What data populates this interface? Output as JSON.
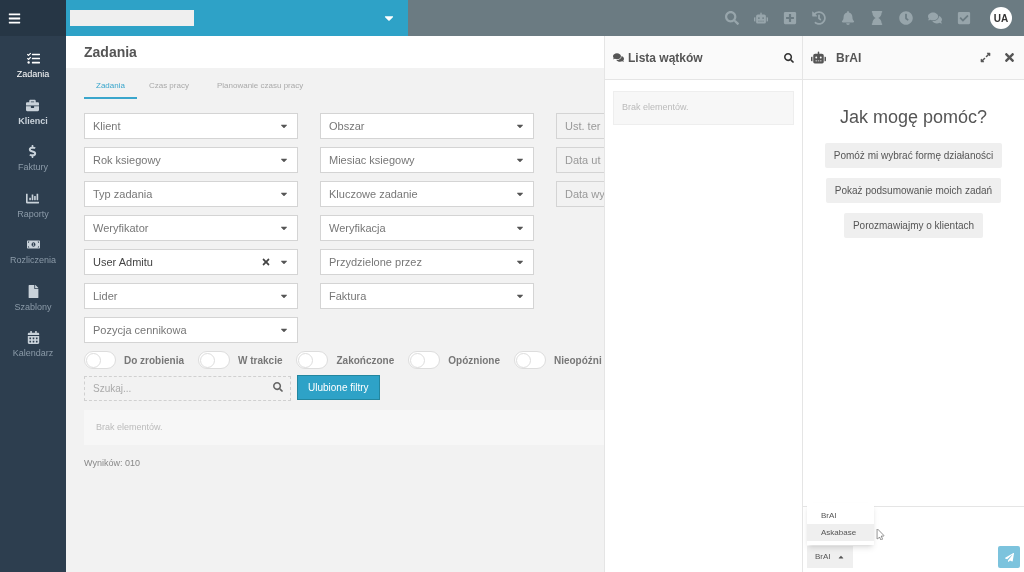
{
  "topbar": {
    "avatar": "UA"
  },
  "sidebar": {
    "items": [
      {
        "label": "Zadania",
        "selected": true,
        "hover": false
      },
      {
        "label": "Klienci",
        "selected": false,
        "hover": true
      },
      {
        "label": "Faktury",
        "selected": false,
        "hover": false
      },
      {
        "label": "Raporty",
        "selected": false,
        "hover": false
      },
      {
        "label": "Rozliczenia",
        "selected": false,
        "hover": false
      },
      {
        "label": "Szablony",
        "selected": false,
        "hover": false
      },
      {
        "label": "Kalendarz",
        "selected": false,
        "hover": false
      }
    ]
  },
  "page": {
    "title": "Zadania",
    "tabs": [
      {
        "label": "Zadania",
        "selected": true
      },
      {
        "label": "Czas pracy",
        "selected": false
      },
      {
        "label": "Planowanie czasu pracy",
        "selected": false
      }
    ],
    "filters_left": [
      {
        "placeholder": "Klient"
      },
      {
        "placeholder": "Rok ksiegowy"
      },
      {
        "placeholder": "Typ zadania"
      },
      {
        "placeholder": "Weryfikator"
      },
      {
        "value": "User Admitu",
        "clearable": true
      },
      {
        "placeholder": "Lider"
      },
      {
        "placeholder": "Pozycja cennikowa"
      }
    ],
    "filters_middle": [
      {
        "placeholder": "Obszar"
      },
      {
        "placeholder": "Miesiac ksiegowy"
      },
      {
        "placeholder": "Kluczowe zadanie"
      },
      {
        "placeholder": "Weryfikacja"
      },
      {
        "placeholder": "Przydzielone przez"
      },
      {
        "placeholder": "Faktura"
      }
    ],
    "filters_right": [
      {
        "placeholder": "Ust. ter"
      },
      {
        "placeholder": "Data ut"
      },
      {
        "placeholder": "Data wy"
      }
    ],
    "toggles": [
      {
        "label": "Do zrobienia",
        "on": false
      },
      {
        "label": "W trakcie",
        "on": false
      },
      {
        "label": "Zakończone",
        "on": false
      },
      {
        "label": "Opóznione",
        "on": false
      },
      {
        "label": "Nieopóźni",
        "on": false
      }
    ],
    "search": {
      "placeholder": "Szukaj..."
    },
    "favorites_button": "Ulubione filtry",
    "empty": "Brak elementów.",
    "results": "Wyników: 010"
  },
  "threads": {
    "title": "Lista wątków",
    "empty": "Brak elementów."
  },
  "assistant": {
    "title": "BrAI",
    "heading": "Jak mogę pomóc?",
    "suggestions": [
      "Pomóż mi wybrać formę działaności",
      "Pokaż podsumowanie moich zadań",
      "Porozmawiajmy o klientach"
    ],
    "model_menu": [
      {
        "label": "BrAI",
        "selected": false
      },
      {
        "label": "Askabase",
        "selected": true
      }
    ],
    "model_button": "BrAI"
  }
}
